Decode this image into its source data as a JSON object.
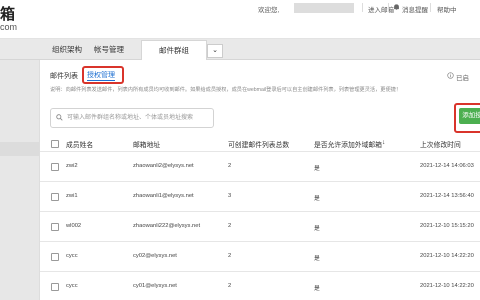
{
  "header": {
    "logo_title": "箱",
    "logo_sub": "com",
    "welcome": "欢迎您,",
    "enter_mail": "进入邮箱",
    "notice": "消息提醒",
    "help": "帮助中"
  },
  "tabs": [
    {
      "label": "组织架构"
    },
    {
      "label": "帐号管理"
    },
    {
      "label": "邮件群组"
    }
  ],
  "tab_dropdown": "⌄",
  "subtabs": {
    "list": "邮件列表",
    "auth": "授权管理",
    "opened": "已启"
  },
  "info_text": "说明：向邮件列表发送邮件，列表内所有成员均可收到邮件。如果给成员授权，成员在webmail登录后可以自主创建邮件列表，列表管理更灵活，更便捷！",
  "search": {
    "placeholder": "可输入邮件群组名称或地址、个体或员地址搜索"
  },
  "add_button": "添加授",
  "table": {
    "headers": [
      "成员姓名",
      "邮箱地址",
      "可创建邮件列表总数",
      "是否允许添加外域邮箱",
      "上次修改时间"
    ],
    "sort_icon": "↓",
    "rows": [
      {
        "name": "zwi2",
        "email": "zhaowanli2@elysys.net",
        "count": "2",
        "allow": "是",
        "time": "2021-12-14 14:06:03"
      },
      {
        "name": "zwi1",
        "email": "zhaowanli1@elysys.net",
        "count": "3",
        "allow": "是",
        "time": "2021-12-14 13:56:40"
      },
      {
        "name": "wl002",
        "email": "zhaowanli222@elysys.net",
        "count": "2",
        "allow": "是",
        "time": "2021-12-10 15:15:20"
      },
      {
        "name": "cycc",
        "email": "cy02@elysys.net",
        "count": "2",
        "allow": "是",
        "time": "2021-12-10 14:22:20"
      },
      {
        "name": "cycc",
        "email": "cy01@elysys.net",
        "count": "2",
        "allow": "是",
        "time": "2021-12-10 14:22:20"
      }
    ]
  },
  "colors": {
    "accent": "#1d6fd1",
    "highlight": "#d9342b",
    "add": "#4caf50"
  }
}
